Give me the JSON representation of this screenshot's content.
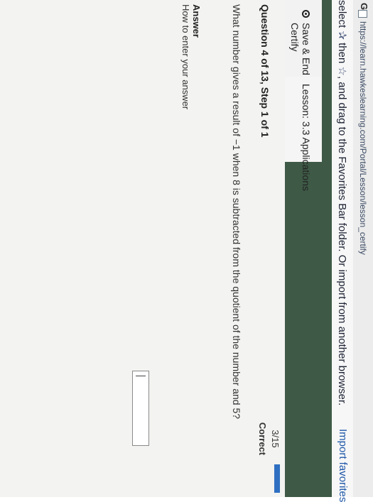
{
  "browser": {
    "go_label": "Go",
    "url": "https://learn.hawkeslearning.com/Portal/Lesson/lesson_certify"
  },
  "favorites_bar": {
    "message_start": "select",
    "message_then": "then",
    "message_end": ", and drag to the Favorites Bar folder. Or import from another browser.",
    "import_link": "Import favorites"
  },
  "nav": {
    "save_end_label": "Save & End Certify",
    "lesson_label": "Lesson: 3.3 Applications"
  },
  "score": {
    "fraction": "3/15",
    "status": "Correct"
  },
  "question": {
    "title": "Question 4 of 13, Step 1 of 1",
    "text": "What number gives a result of −1 when 8 is subtracted from the quotient of the number and 5?"
  },
  "answer": {
    "label": "Answer",
    "help_link": "How to enter your answer",
    "value": ""
  },
  "colors": {
    "nav_green": "#3e5a46",
    "progress_blue": "#2f6fc2",
    "link_blue": "#1e57a8"
  }
}
